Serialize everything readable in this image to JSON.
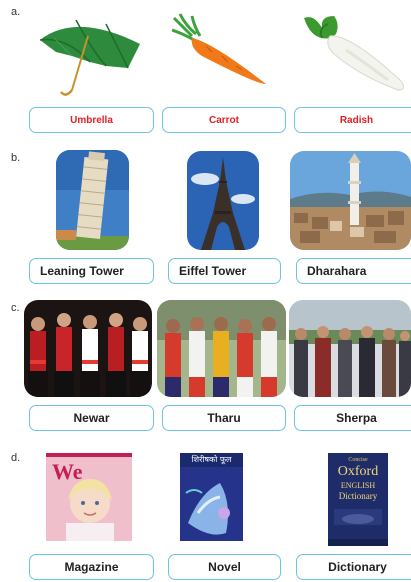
{
  "sections": [
    {
      "letter": "a.",
      "items": [
        {
          "label": "Umbrella"
        },
        {
          "label": "Carrot"
        },
        {
          "label": "Radish"
        }
      ]
    },
    {
      "letter": "b.",
      "items": [
        {
          "label": "Leaning Tower"
        },
        {
          "label": "Eiffel Tower"
        },
        {
          "label": "Dharahara"
        }
      ]
    },
    {
      "letter": "c.",
      "items": [
        {
          "label": "Newar"
        },
        {
          "label": "Tharu"
        },
        {
          "label": "Sherpa"
        }
      ]
    },
    {
      "letter": "d.",
      "items": [
        {
          "label": "Magazine"
        },
        {
          "label": "Novel"
        },
        {
          "label": "Dictionary"
        }
      ]
    }
  ],
  "book_covers": {
    "magazine_title": "We",
    "novel_title": "शिरीषको फूल",
    "dictionary_line1": "Concise",
    "dictionary_line2": "Oxford",
    "dictionary_line3": "ENGLISH",
    "dictionary_line4": "Dictionary"
  },
  "colors": {
    "label_border": "#6cc4e6",
    "label_text_red": "#e31e24",
    "label_text": "#222222"
  }
}
